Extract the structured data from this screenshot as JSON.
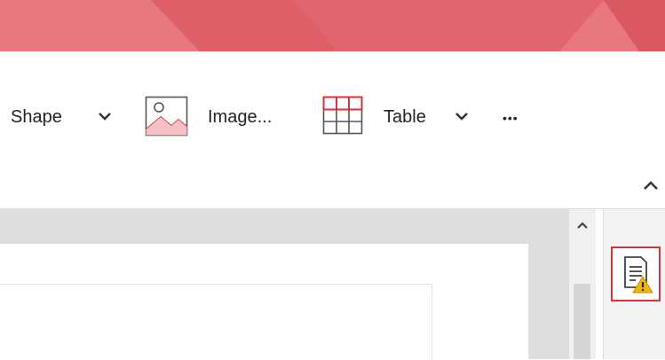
{
  "ribbon": {
    "shape_label": "Shape",
    "image_label": "Image...",
    "table_label": "Table",
    "more_label": "•••"
  },
  "colors": {
    "titlebar": "#e0656e",
    "accent": "#d13438",
    "warning": "#f2b600"
  },
  "icons": [
    "chevron-down-icon",
    "image-icon",
    "table-icon",
    "more-icon",
    "collapse-ribbon-icon",
    "scroll-up-icon",
    "accessibility-checker-icon",
    "warning-icon"
  ]
}
